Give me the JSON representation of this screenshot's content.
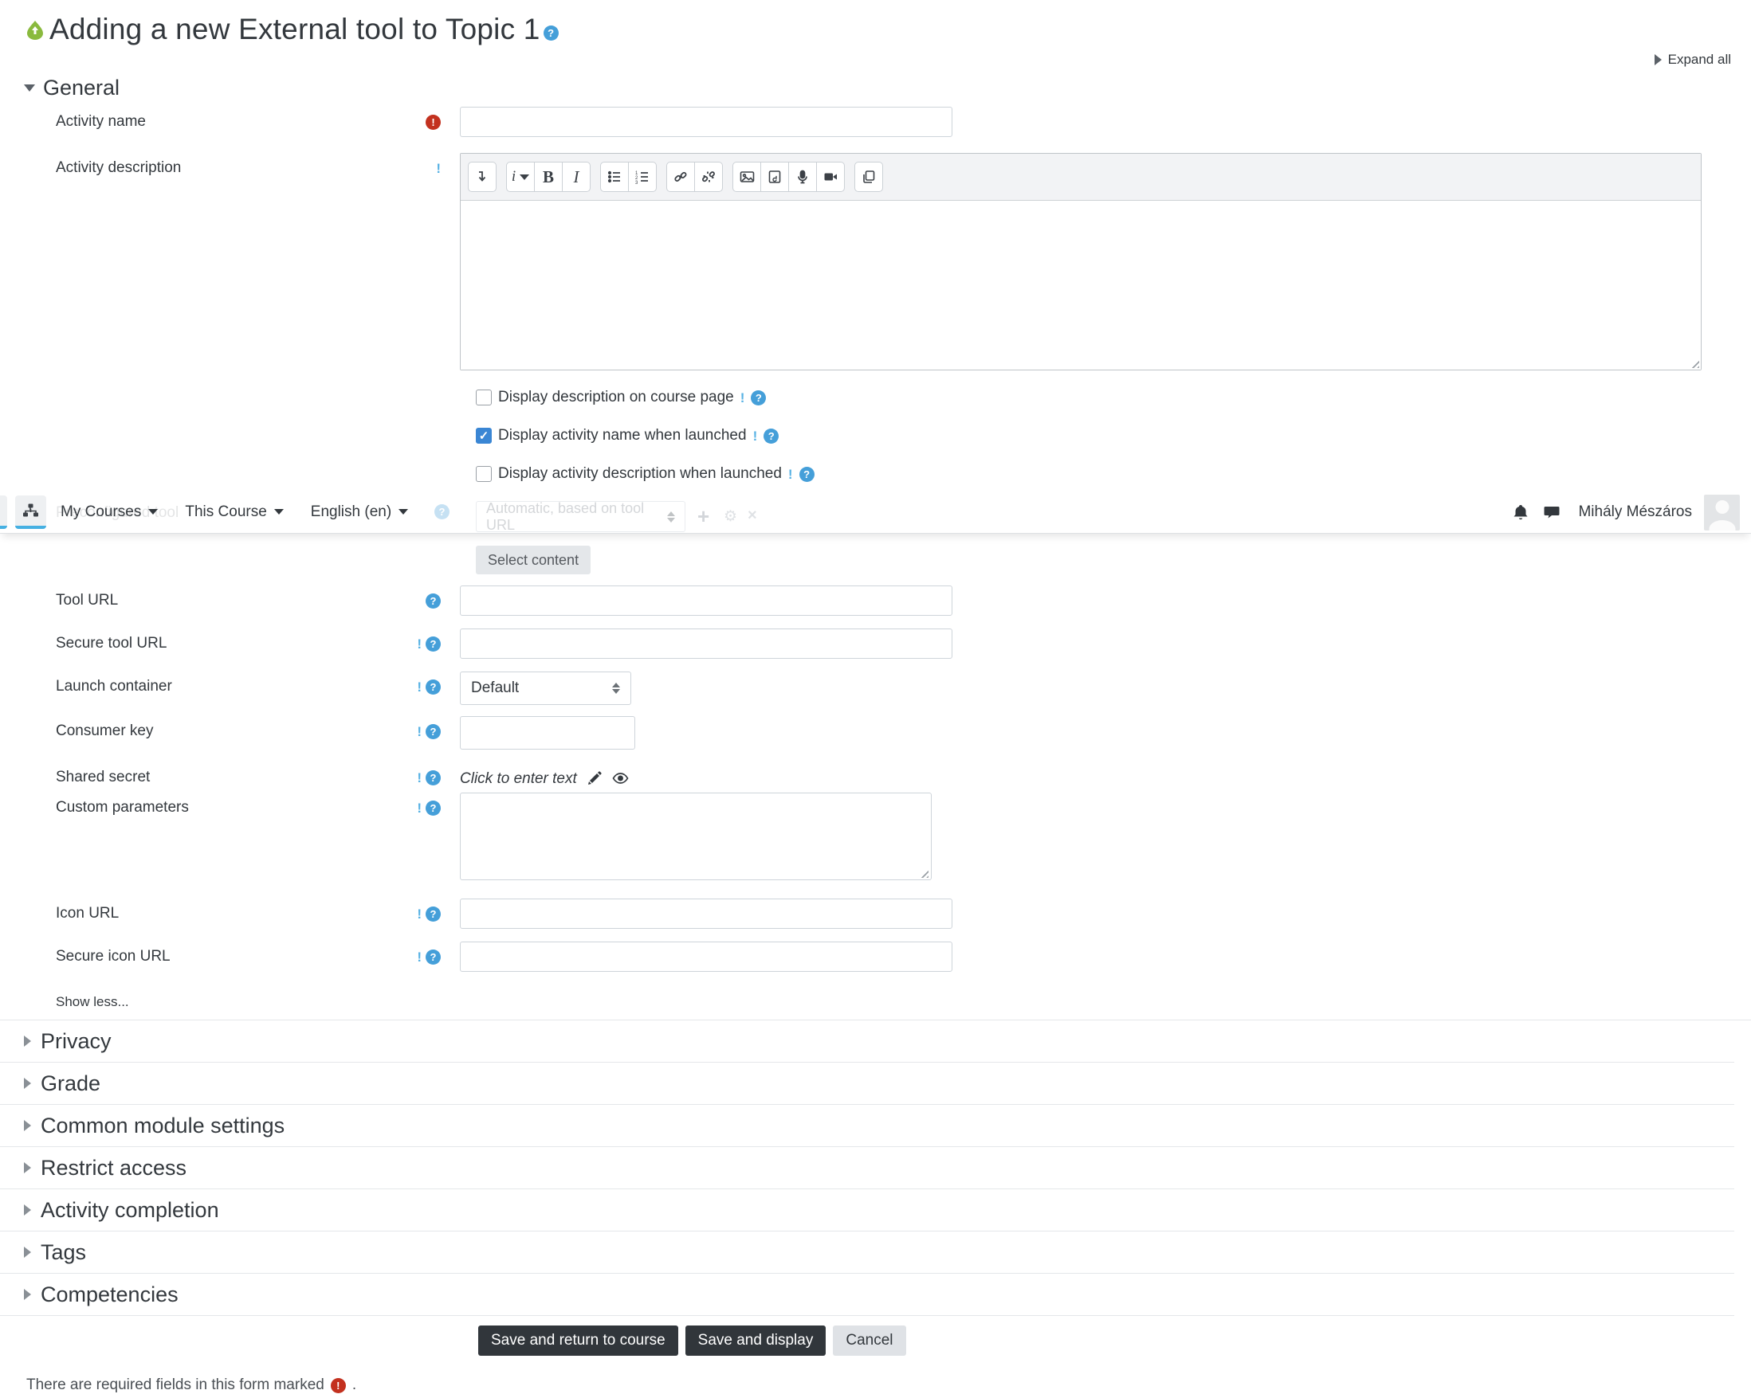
{
  "header": {
    "title": "Adding a new External tool to Topic 1",
    "expand_all": "Expand all"
  },
  "navbar": {
    "my_courses": "My Courses",
    "this_course": "This Course",
    "language": "English (en)",
    "user_name": "Mihály Mészáros"
  },
  "general": {
    "heading": "General",
    "activity_name_label": "Activity name",
    "activity_description_label": "Activity description",
    "checkboxes": [
      {
        "label": "Display description on course page",
        "checked": false
      },
      {
        "label": "Display activity name when launched",
        "checked": true
      },
      {
        "label": "Display activity description when launched",
        "checked": false
      }
    ],
    "preconfigured_tool_ghost_label": "Preconfigured tool",
    "preconfigured_tool_value": "Automatic, based on tool URL",
    "select_content_label": "Select content",
    "tool_url_label": "Tool URL",
    "secure_tool_url_label": "Secure tool URL",
    "launch_container_label": "Launch container",
    "launch_container_value": "Default",
    "consumer_key_label": "Consumer key",
    "shared_secret_label": "Shared secret",
    "shared_secret_value": "Click to enter text",
    "custom_parameters_label": "Custom parameters",
    "icon_url_label": "Icon URL",
    "secure_icon_url_label": "Secure icon URL",
    "show_less": "Show less..."
  },
  "sections": [
    "Privacy",
    "Grade",
    "Common module settings",
    "Restrict access",
    "Activity completion",
    "Tags",
    "Competencies"
  ],
  "actions": {
    "save_return": "Save and return to course",
    "save_display": "Save and display",
    "cancel": "Cancel"
  },
  "footer": {
    "required_note": "There are required fields in this form marked",
    "period": "."
  },
  "editor_toolbar_icons": [
    "collapse-toolbar-icon",
    "paragraph-style-icon",
    "bold-icon",
    "italic-icon",
    "unordered-list-icon",
    "ordered-list-icon",
    "link-icon",
    "unlink-icon",
    "insert-image-icon",
    "insert-media-icon",
    "record-audio-icon",
    "record-video-icon",
    "manage-files-icon"
  ],
  "colors": {
    "help_blue": "#459fd9",
    "hint_blue": "#58b2e4",
    "checked_blue": "#3a86d4",
    "required_red": "#c3311f",
    "brand_green": "#8aba3e",
    "dark_button": "#31363b",
    "nav_underline_blue": "#45b0e2"
  }
}
